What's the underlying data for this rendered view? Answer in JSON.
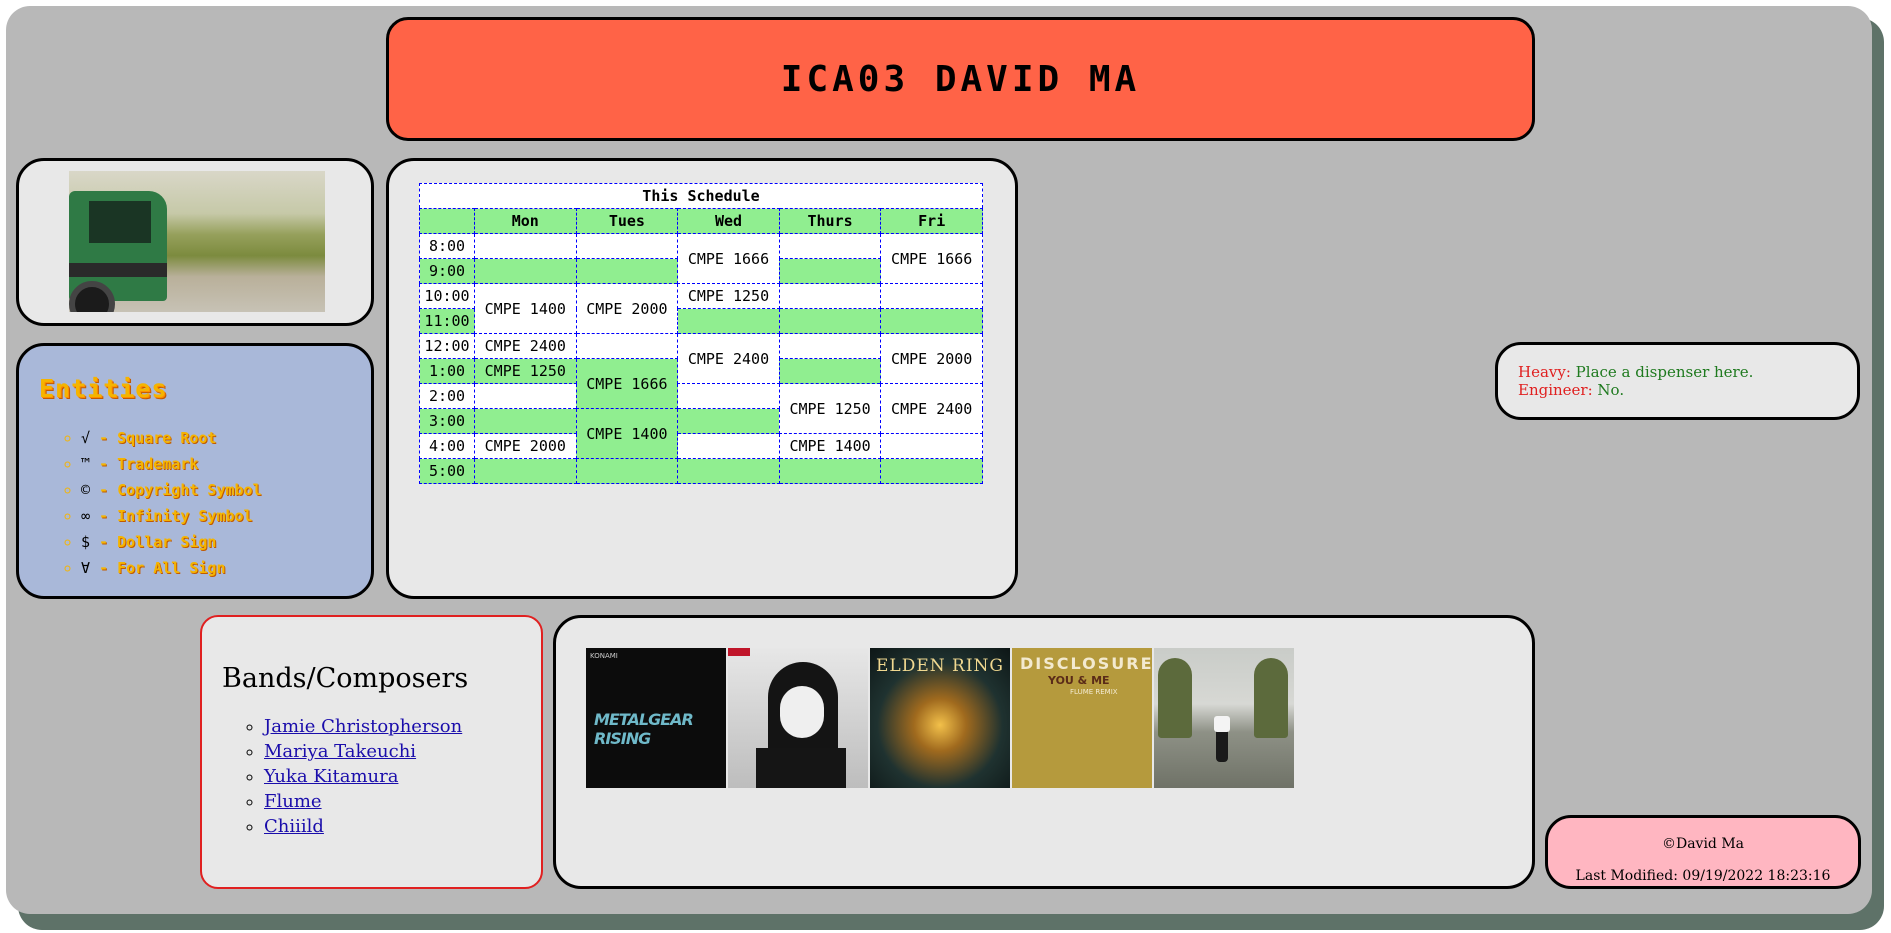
{
  "header": {
    "title": "ICA03 DAVID MA"
  },
  "entities": {
    "heading": "Entities",
    "items": [
      {
        "symbol": "√",
        "label": " - Square Root"
      },
      {
        "symbol": "™",
        "label": " - Trademark"
      },
      {
        "symbol": "©",
        "label": " - Copyright Symbol"
      },
      {
        "symbol": "∞",
        "label": " - Infinity Symbol"
      },
      {
        "symbol": "$",
        "label": " - Dollar Sign"
      },
      {
        "symbol": "∀",
        "label": " - For All Sign"
      }
    ]
  },
  "schedule": {
    "caption": "This Schedule",
    "days": [
      "Mon",
      "Tues",
      "Wed",
      "Thurs",
      "Fri"
    ],
    "times": [
      "8:00",
      "9:00",
      "10:00",
      "11:00",
      "12:00",
      "1:00",
      "2:00",
      "3:00",
      "4:00",
      "5:00"
    ],
    "courses": {
      "wed_8": "CMPE 1666",
      "fri_8": "CMPE 1666",
      "mon_10": "CMPE 1400",
      "tue_10": "CMPE 2000",
      "wed_10": "CMPE 1250",
      "mon_12": "CMPE 2400",
      "wed_12": "CMPE 2400",
      "fri_12": "CMPE 2000",
      "mon_1": "CMPE 1250",
      "tue_1": "CMPE 1666",
      "thu_2": "CMPE 1250",
      "fri_2": "CMPE 2400",
      "tue_3": "CMPE 1400",
      "mon_4": "CMPE 2000",
      "thu_4": "CMPE 1400"
    }
  },
  "heavy": {
    "line1_label": "Heavy:",
    "line1_value": " Place a dispenser here.",
    "line2_label": "Engineer:",
    "line2_value": " No."
  },
  "bands": {
    "heading": "Bands/Composers",
    "links": [
      "Jamie Christopherson",
      "Mariya Takeuchi",
      "Yuka Kitamura",
      "Flume",
      "Chiiild"
    ]
  },
  "albums": {
    "c1_brand": "KONAMI",
    "c1_title": "METALGEAR RISING",
    "c3_title": "ELDEN RING",
    "c4_title": "DISCLOSURE",
    "c4_sub": "YOU & ME",
    "c4_sub2": "FLUME REMIX"
  },
  "footer": {
    "copyright": "©David Ma",
    "modified": "Last Modified: 09/19/2022 18:23:16"
  },
  "colors": {
    "header_bg": "#ff6347",
    "schedule_green": "#90ee90",
    "entities_bg": "#a9b8d9",
    "footer_bg": "#ffb6c1",
    "frame_bg": "#b8b8b8"
  }
}
